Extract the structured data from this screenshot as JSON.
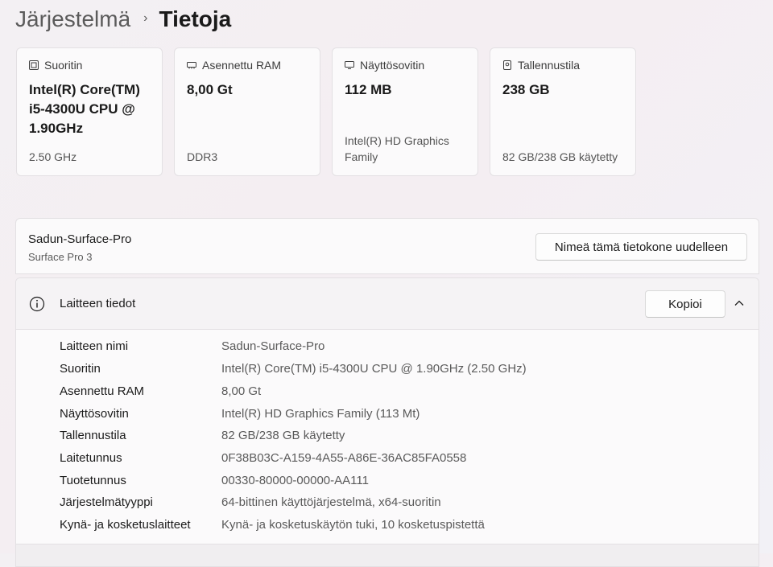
{
  "breadcrumb": {
    "parent": "Järjestelmä",
    "separator": "›",
    "current": "Tietoja"
  },
  "cards": [
    {
      "title": "Suoritin",
      "icon": "processor-icon",
      "value": "Intel(R) Core(TM) i5-4300U CPU @ 1.90GHz",
      "sub": "2.50 GHz"
    },
    {
      "title": "Asennettu RAM",
      "icon": "memory-icon",
      "value": "8,00 Gt",
      "sub": "DDR3"
    },
    {
      "title": "Näyttösovitin",
      "icon": "display-adapter-icon",
      "value": "112 MB",
      "sub": "Intel(R) HD Graphics Family"
    },
    {
      "title": "Tallennustila",
      "icon": "storage-icon",
      "value": "238 GB",
      "sub": "82 GB/238 GB käytetty"
    }
  ],
  "device": {
    "name": "Sadun-Surface-Pro",
    "model": "Surface Pro 3",
    "rename_label": "Nimeä tämä tietokone uudelleen"
  },
  "details": {
    "title": "Laitteen tiedot",
    "copy_label": "Kopioi",
    "rows": [
      {
        "label": "Laitteen nimi",
        "value": "Sadun-Surface-Pro"
      },
      {
        "label": "Suoritin",
        "value": "Intel(R) Core(TM) i5-4300U CPU @ 1.90GHz (2.50 GHz)"
      },
      {
        "label": "Asennettu RAM",
        "value": "8,00 Gt"
      },
      {
        "label": "Näyttösovitin",
        "value": "Intel(R) HD Graphics Family (113 Mt)"
      },
      {
        "label": "Tallennustila",
        "value": "82 GB/238 GB käytetty"
      },
      {
        "label": "Laitetunnus",
        "value": "0F38B03C-A159-4A55-A86E-36AC85FA0558"
      },
      {
        "label": "Tuotetunnus",
        "value": "00330-80000-00000-AA111"
      },
      {
        "label": "Järjestelmätyyppi",
        "value": "64-bittinen käyttöjärjestelmä, x64-suoritin"
      },
      {
        "label": "Kynä- ja kosketuslaitteet",
        "value": "Kynä- ja kosketuskäytön tuki, 10 kosketuspistettä"
      }
    ]
  }
}
